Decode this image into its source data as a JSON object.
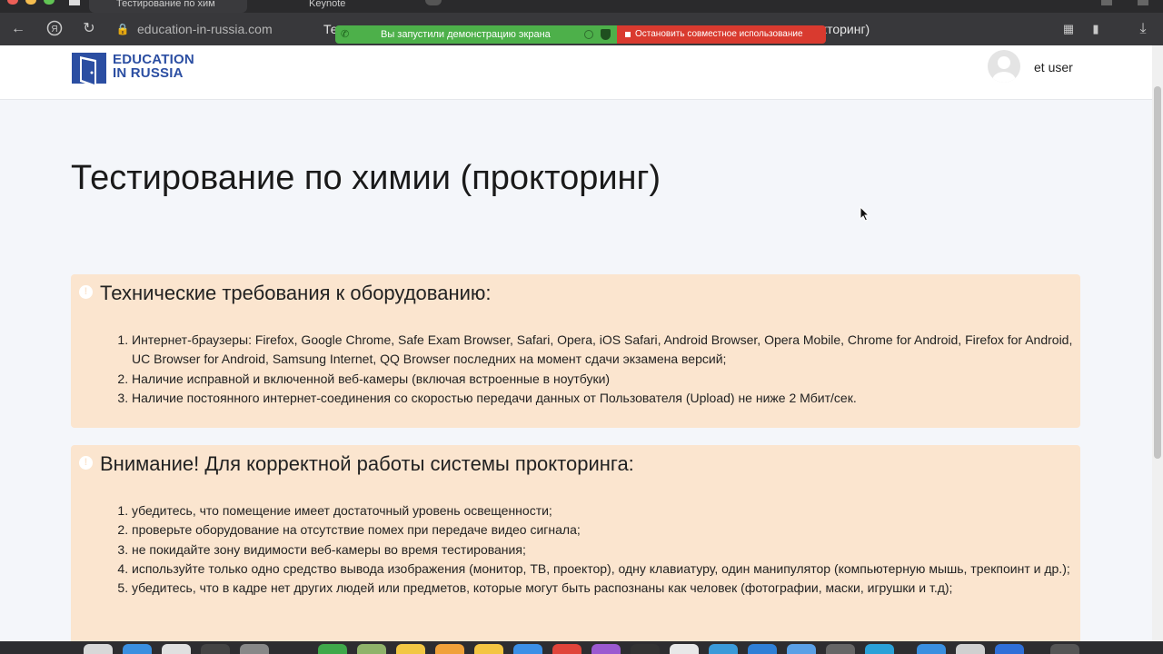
{
  "browser": {
    "tabs": [
      {
        "label": "Тестирование по хим",
        "active": true
      },
      {
        "label": "Keynote",
        "active": false
      }
    ],
    "url": "education-in-russia.com",
    "tab_title_prefix": "Те",
    "tab_title_suffix": "окторинг)"
  },
  "share_banner": {
    "message": "Вы запустили демонстрацию экрана",
    "stop_label": "Остановить совместное использование"
  },
  "site": {
    "logo_line1": "EDUCATION",
    "logo_line2": "IN RUSSIA",
    "username": "et user",
    "brand_color": "#2b4ea2"
  },
  "page": {
    "title": "Тестирование по химии (прокторинг)",
    "requirements": {
      "title": "Технические требования к оборудованию:",
      "items": [
        "Интернет-браузеры: Firefox, Google Chrome, Safe Exam Browser, Safari, Opera, iOS Safari, Android Browser, Opera Mobile, Chrome for Android, Firefox for Android, UC Browser for Android, Samsung Internet, QQ Browser последних на момент сдачи экзамена версий;",
        "Наличие исправной и включенной веб-камеры (включая встроенные в ноутбуки)",
        "Наличие постоянного интернет-соединения со скоростью передачи данных от Пользователя (Upload) не ниже 2 Мбит/сек."
      ]
    },
    "attention": {
      "title": "Внимание! Для корректной работы системы прокторинга:",
      "items": [
        "убедитесь, что помещение имеет достаточный уровень освещенности;",
        "проверьте оборудование на отсутствие помех при передаче видео сигнала;",
        "не покидайте зону видимости веб-камеры во время тестирования;",
        "используйте только одно средство вывода изображения (монитор, ТВ, проектор), одну клавиатуру, один манипулятор (компьютерную мышь, трекпоинт и др.);",
        "убедитесь, что в кадре нет других людей или предметов, которые могут быть распознаны как человек (фотографии, маски, игрушки и т.д);"
      ]
    }
  },
  "colors": {
    "alert_bg": "#fbe5cf",
    "share_green": "#4db04a",
    "share_red": "#d93a2f"
  }
}
